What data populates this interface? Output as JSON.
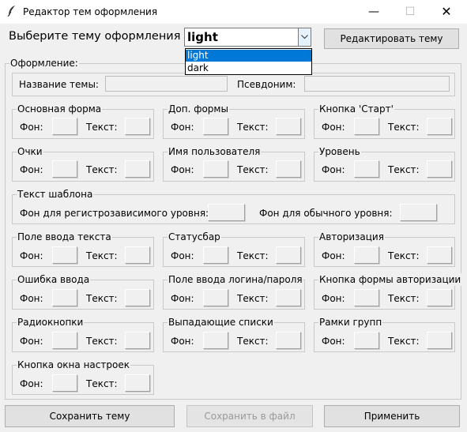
{
  "window": {
    "title": "Редактор тем оформления",
    "minimize_glyph": "—",
    "maximize_glyph": "☐",
    "close_glyph": "✕"
  },
  "top": {
    "select_label": "Выберите тему оформления >",
    "selected_theme": "light",
    "edit_button": "Редактировать тему"
  },
  "dropdown": {
    "options": [
      "light",
      "dark"
    ],
    "highlighted": "light"
  },
  "design": {
    "title": "Оформление:",
    "theme_name_label": "Название темы:",
    "alias_label": "Псевдоним:"
  },
  "labels": {
    "bg": "Фон:",
    "text": "Текст:"
  },
  "groups": {
    "main_form": "Основная форма",
    "extra_forms": "Доп. формы",
    "start_button": "Кнопка 'Старт'",
    "points": "Очки",
    "username": "Имя пользователя",
    "level": "Уровень",
    "text_input": "Поле ввода текста",
    "statusbar": "Статусбар",
    "authorization": "Авторизация",
    "input_error": "Ошибка ввода",
    "login_field": "Поле ввода логина/пароля",
    "auth_button": "Кнопка формы авторизации",
    "radio_buttons": "Радиокнопки",
    "dropdown_lists": "Выпадающие списки",
    "group_frames": "Рамки групп",
    "settings_button": "Кнопка окна настроек"
  },
  "template_text": {
    "title": "Текст шаблона",
    "case_sensitive_bg": "Фон для регистрозависимого уровня:",
    "normal_bg": "Фон для обычного уровня:"
  },
  "bottom": {
    "save_theme": "Сохранить тему",
    "save_to_file": "Сохранить в файл",
    "apply": "Применить"
  },
  "colors": {
    "window_bg": "#f0f0f0",
    "titlebar_bg": "#ffffff",
    "selection": "#0078d7",
    "disabled_text": "#9a9a9a"
  }
}
